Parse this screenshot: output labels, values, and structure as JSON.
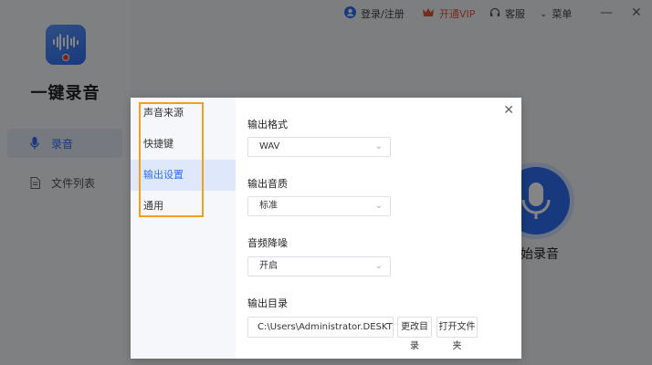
{
  "app": {
    "name": "一键录音"
  },
  "sidebar": {
    "items": [
      {
        "label": "录音",
        "icon": "mic-icon",
        "active": true
      },
      {
        "label": "文件列表",
        "icon": "file-icon",
        "active": false
      }
    ]
  },
  "topbar": {
    "login": "登录/注册",
    "vip": "开通VIP",
    "support": "客服",
    "menu": "菜单"
  },
  "main": {
    "record_label": "开始录音",
    "record_label_visible": "始录音"
  },
  "dialog": {
    "tabs": [
      "声音来源",
      "快捷键",
      "输出设置",
      "通用"
    ],
    "active_tab": "输出设置",
    "format": {
      "label": "输出格式",
      "value": "WAV"
    },
    "quality": {
      "label": "输出音质",
      "value": "标准"
    },
    "noise": {
      "label": "音频降噪",
      "value": "开启"
    },
    "dir": {
      "label": "输出目录",
      "value": "C:\\Users\\Administrator.DESKTOP",
      "change_button": "更改目录",
      "open_button": "打开文件夹"
    }
  },
  "colors": {
    "accent": "#2f6ef0",
    "vip": "#e5543d",
    "highlight_box": "#f0a020"
  }
}
